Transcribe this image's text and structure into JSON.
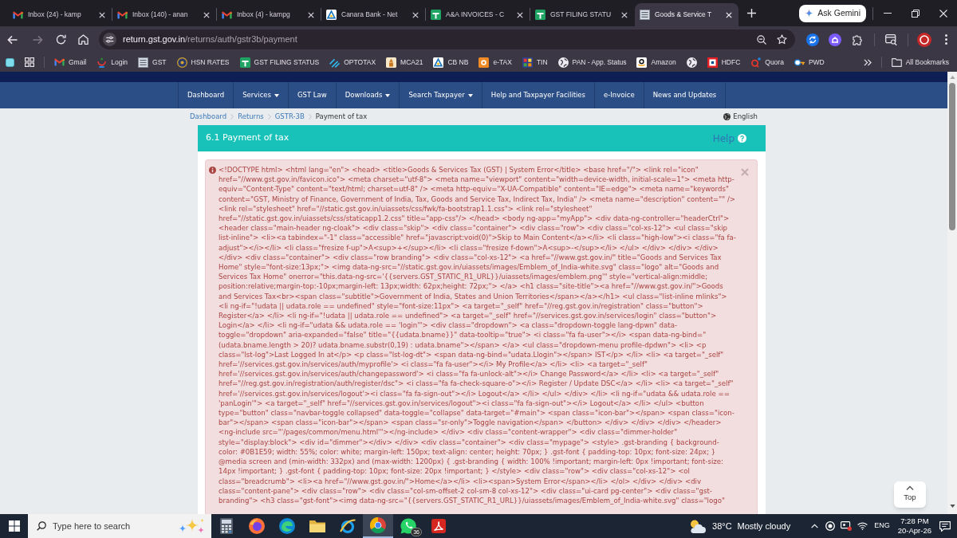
{
  "browser": {
    "tabs": [
      {
        "kind": "mail",
        "title": "Inbox (24) - kamp",
        "selected": false
      },
      {
        "kind": "mail",
        "title": "Inbox (140) - anan",
        "selected": false
      },
      {
        "kind": "mail",
        "title": "Inbox (4) - kampg",
        "selected": false
      },
      {
        "kind": "bank",
        "title": "Canara Bank - Net",
        "selected": false
      },
      {
        "kind": "sheet",
        "title": "A&A INVOICES - C",
        "selected": false
      },
      {
        "kind": "sheet",
        "title": "GST FILING STATU",
        "selected": false
      },
      {
        "kind": "portal",
        "title": "Goods & Service T",
        "selected": true
      }
    ],
    "gemini_button": "Ask Gemini",
    "address": {
      "host": "return.gst.gov.in",
      "path": "/returns/auth/gstr3b/payment"
    },
    "bookmarks": [
      {
        "kind": "mail",
        "label": "Gmail"
      },
      {
        "kind": "login",
        "label": "Login"
      },
      {
        "kind": "portal",
        "label": "GST"
      },
      {
        "kind": "seal",
        "label": "HSN RATES"
      },
      {
        "kind": "sheet",
        "label": "GST FILING STATUS"
      },
      {
        "kind": "stripes",
        "label": "OPTOTAX"
      },
      {
        "kind": "emblem",
        "label": "MCA21"
      },
      {
        "kind": "bank",
        "label": "CB NB"
      },
      {
        "kind": "tax",
        "label": "e-TAX"
      },
      {
        "kind": "mosaic",
        "label": "TIN"
      },
      {
        "kind": "globe",
        "label": "PAN - App. Status"
      },
      {
        "kind": "amazon",
        "label": "Amazon"
      },
      {
        "kind": "globe"
      },
      {
        "kind": "hdfc",
        "label": "HDFC"
      },
      {
        "kind": "quora",
        "label": "Quora"
      },
      {
        "kind": "key",
        "label": "PWD"
      }
    ],
    "all_bookmarks": "All Bookmarks"
  },
  "portal": {
    "menu": [
      {
        "label": "Dashboard",
        "dropdown": false
      },
      {
        "label": "Services",
        "dropdown": true
      },
      {
        "label": "GST Law",
        "dropdown": false
      },
      {
        "label": "Downloads",
        "dropdown": true
      },
      {
        "label": "Search Taxpayer",
        "dropdown": true
      },
      {
        "label": "Help and Taxpayer Facilities",
        "dropdown": false
      },
      {
        "label": "e-Invoice",
        "dropdown": false
      },
      {
        "label": "News and Updates",
        "dropdown": false
      }
    ],
    "breadcrumb": [
      {
        "label": "Dashboard",
        "current": false
      },
      {
        "label": "Returns",
        "current": false
      },
      {
        "label": "GSTR-3B",
        "current": false
      },
      {
        "label": "Payment of tax",
        "current": true
      }
    ],
    "language": "English",
    "section": {
      "title": "6.1 Payment of tax",
      "help": "Help"
    },
    "error_alert": {
      "message": "<!DOCTYPE html> <html lang=\"en\"> <head> <title>Goods & Services Tax (GST) | System Error</title> <base href=\"/\"> <link rel=\"icon\" href=\"//www.gst.gov.in/favicon.ico\"> <meta charset=\"utf-8\"> <meta name=\"viewport\" content=\"width=device-width, initial-scale=1\"> <meta http-equiv=\"Content-Type\" content=\"text/html; charset=utf-8\" /> <meta http-equiv=\"X-UA-Compatible\" content=\"IE=edge\"> <meta name=\"keywords\" content=\"GST, Ministry of Finance, Government of India, Tax, Goods and Service Tax, Indirect Tax, India\" /> <meta name=\"description\" content=\"\" /> <link rel=\"stylesheet\" href=\"//static.gst.gov.in/uiassets/css/fwk/fa-bootstrap1.1.css\"> <link rel=\"stylesheet\" href=\"//static.gst.gov.in/uiassets/css/staticapp1.2.css\" title=\"app-css\"/> </head> <body ng-app=\"myApp\"> <div data-ng-controller=\"headerCtrl\"> <header class=\"main-header ng-cloak\"> <div class=\"skip\"> <div class=\"container\"> <div class=\"row\"> <div class=\"col-xs-12\"> <ul class=\"skip list-inline\"> <li><a tabindex=\"-1\" class=\"accessible\" href=\"javascript:void(0)\">Skip to Main Content</a></li> <li class=\"high-low\"><i class=\"fa fa-adjust\"></i></li> <li class=\"fresize f-up\">A<sup>+</sup></li> <li class=\"fresize f-down\">A<sup>-</sup></li> </ul> </div> </div> </div> </div> <div class=\"container\"> <div class=\"row branding\"> <div class=\"col-xs-12\"> <a href=\"//www.gst.gov.in/\" title=\"Goods and Services Tax Home\" style=\"font-size:13px;\"> <img data-ng-src=\"//static.gst.gov.in/uiassets/images/Emblem_of_India-white.svg\" class=\"logo\" alt=\"Goods and Services Tax Home\" onerror=\"this.data-ng-src='{{servers.GST_STATIC_R1_URL}}/uiassets/images/emblem.png'\" style=\"vertical-align:middle; position:relative;margin-top:-10px;margin-left: 13px;width: 62px;height: 72px;\"> </a> <h1 class=\"site-title\"><a href=\"//www.gst.gov.in/\">Goods and Services Tax<br><span class=\"subtitle\">Government of India, States and Union Territories</span></a></h1> <ul class=\"list-inline mlinks\"> <li ng-if=\"!udata || udata.role == undefined\" style=\"font-size:11px\"> <a target=\"_self\" href=\"//reg.gst.gov.in/registration\" class=\"button\"> Register</a> </li> <li ng-if=\"!udata || udata.role == undefined\"> <a target=\"_self\" href=\"//services.gst.gov.in/services/login\" class=\"button\"> Login</a> </li> <li ng-if=\"udata && udata.role == 'login'\"> <div class=\"dropdown\"> <a class=\"dropdown-toggle lang-dpwn\" data-toggle=\"dropdown\" aria-expanded=\"false\" title=\"{{udata.bname}}\" data-tooltip=\"true\"> <i class=\"fa fa-user\"></i> <span data-ng-bind=\"(udata.bname.length > 20)? udata.bname.substr(0,19) : udata.bname\"></span> </a> <ul class=\"dropdown-menu profile-dpdwn\"> <li> <p class=\"lst-log\">Last Logged In at</p> <p class=\"lst-log-dt\"> <span data-ng-bind=\"udata.Llogin\"></span> IST</p> </li> <li> <a target=\"_self\" href='//services.gst.gov.in/services/auth/myprofile'> <i class=\"fa fa-user\"></i> My Profile</a> </li> <li> <a target=\"_self\" href='//services.gst.gov.in/services/auth/changepassword'> <i class=\"fa fa-unlock-alt\"></i> Change Password</a> </li> <li> <a target=\"_self\" href=\"//reg.gst.gov.in/registration/auth/register/dsc\"> <i class=\"fa fa-check-square-o\"></i> Register / Update DSC</a> </li> <li> <a target=\"_self\" href='//services.gst.gov.in/services/logout'><i class=\"fa fa-sign-out\"></i> Logout</a> </li> </ul> </div> </li> <li ng-if=\"udata && udata.role == 'panLogin'\"> <a target=\"_self\" href=\"//services.gst.gov.in/services/logout\"><i class=\"fa fa-sign-out\"></i> Logout</a> </li> </ul> <button type=\"button\" class=\"navbar-toggle collapsed\" data-toggle=\"collapse\" data-target=\"#main\"> <span class=\"icon-bar\"></span> <span class=\"icon-bar\"></span> <span class=\"icon-bar\"></span> <span class=\"sr-only\">Toggle navigation</span> </button> </div> </div> </div> </header> <ng-include src=\"'/pages/common/menu.html'\"></ng-include> </div> <div class=\"content-wrapper\"> <div class=\"dimmer-holder\" style=\"display:block\"> <div id=\"dimmer\"></div> </div> <div class=\"container\"> <div class=\"mypage\"> <style> .gst-branding { background-color: #0B1E59; width: 55%; color: white; margin-left: 150px; text-align: center; height: 70px; } .gst-font { padding-top: 10px; font-size: 24px; } @media screen and (min-width: 332px) and (max-width: 1200px) { .gst-branding { width: 100% !important; margin-left: 0px !important; font-size: 14px !important; } .gst-font { padding-top: 10px; font-size: 20px !important; } </style> <div class=\"row\"> <div class=\"col-xs-12\"> <ol class=\"breadcrumb\"> <li><a href=\"//www.gst.gov.in/\">Home</a></li> <li><span>System Error</span></li> </ol> </div> </div> <div class=\"content-pane\"> <div class=\"row\"> <div class=\"col-sm-offset-2 col-sm-8 col-xs-12\"> <div class=\"ui-card pg-center\"> <div class=\"gst-branding\"> <h3 class=\"gst-font\"><img data-ng-src=\"{{servers.GST_STATIC_R1_URL}}/uiassets/images/Emblem_of_India-white.svg\" class=\"logo\""
    },
    "top_button": "Top"
  },
  "taskbar": {
    "search": {
      "placeholder": "Type here to search"
    },
    "apps": [
      {
        "kind": "calculator",
        "selected": false
      },
      {
        "kind": "fox",
        "selected": false
      },
      {
        "kind": "wave",
        "selected": false
      },
      {
        "kind": "folder",
        "selected": false
      },
      {
        "kind": "ring",
        "selected": false
      },
      {
        "kind": "orb",
        "selected": true
      },
      {
        "kind": "chat",
        "selected": false,
        "badge": "36"
      },
      {
        "kind": "pdf",
        "selected": false
      }
    ],
    "weather": {
      "temperature": "38°C",
      "condition": "Mostly cloudy"
    },
    "language": "ENG",
    "time": "7:28 PM",
    "date": "20-Apr-26"
  }
}
